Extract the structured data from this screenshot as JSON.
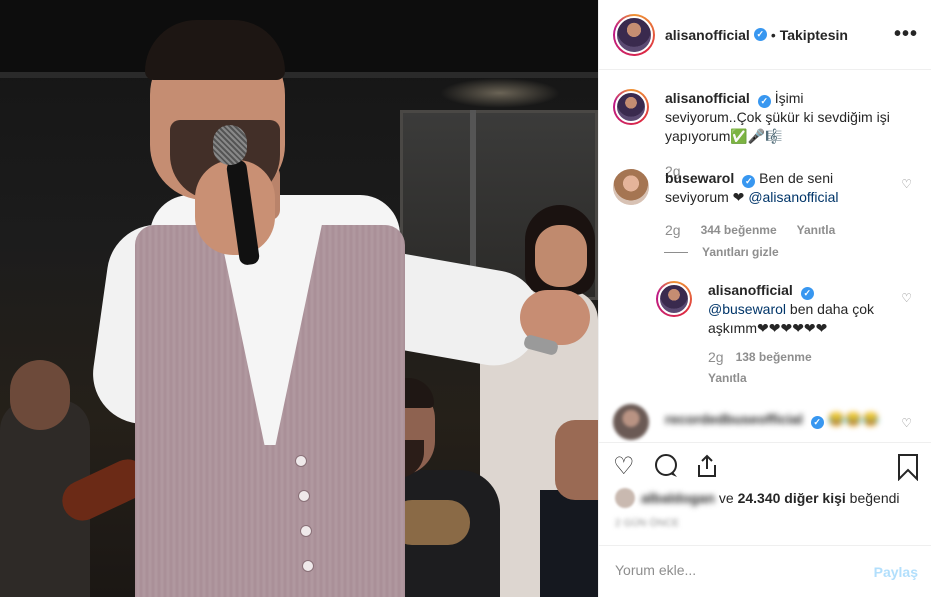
{
  "header": {
    "username": "alisanofficial",
    "dot": "•",
    "follow_status": "Takiptesin",
    "more_label": "•••"
  },
  "caption": {
    "username": "alisanofficial",
    "text": "İşimi seviyorum..Çok şükür ki sevdiğim işi yapıyorum✅🎤🎼",
    "time": "2g"
  },
  "comments": [
    {
      "username": "busewarol",
      "text": "Ben de seni seviyorum ❤",
      "mention": "@alisanofficial",
      "time": "2g",
      "likes": "344 beğenme",
      "reply_label": "Yanıtla",
      "hide_replies": "Yanıtları gizle",
      "replies": [
        {
          "username": "alisanofficial",
          "mention": "@busewarol",
          "text": "ben daha çok aşkımm❤❤❤❤❤❤",
          "time": "2g",
          "likes": "138 beğenme",
          "reply_label": "Yanıtla"
        }
      ]
    },
    {
      "username": "recordedbuseofficial",
      "text": "😂😂😂"
    }
  ],
  "actions": {
    "like_icon": "heart-icon",
    "comment_icon": "comment-icon",
    "share_icon": "share-icon",
    "save_icon": "bookmark-icon"
  },
  "likes_line": {
    "blurred_user": "albaldogan",
    "connector": "ve",
    "count_text": "24.340 diğer kişi",
    "suffix": "beğendi"
  },
  "post_age": "2 GÜN ÖNCE",
  "add_comment": {
    "placeholder": "Yorum ekle...",
    "submit_label": "Paylaş"
  },
  "colors": {
    "verified": "#3897f0",
    "mention": "#003569",
    "share_disabled": "#b2dffc",
    "muted": "#8e8e8e"
  }
}
